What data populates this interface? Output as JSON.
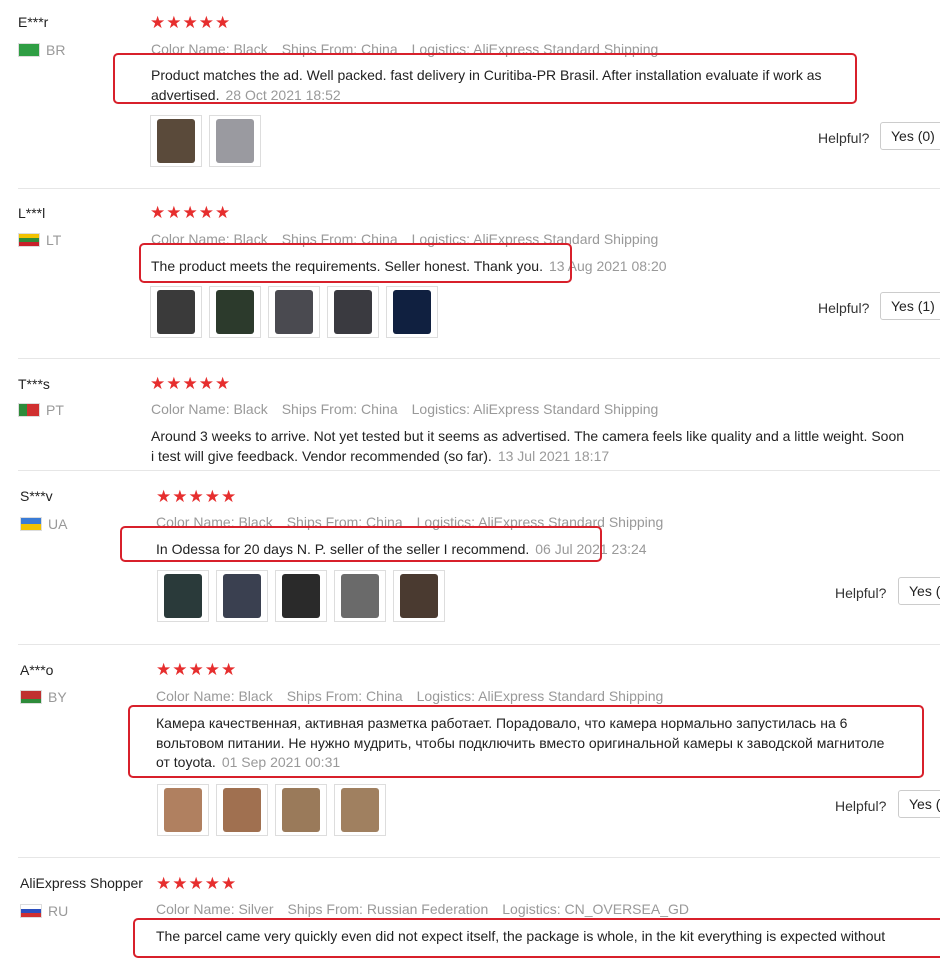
{
  "reviews": [
    {
      "user": "E***r",
      "country": "BR",
      "flag_color": "#2f9e44",
      "stars": "★★★★★",
      "color": "Color Name: Black",
      "ships": "Ships From: China",
      "logistics": "Logistics: AliExpress Standard Shipping",
      "text": "Product matches the ad. Well packed. fast delivery in Curitiba-PR Brasil. After installation evaluate if work as advertised.",
      "date": "28 Oct 2021 18:52",
      "helpful": "Helpful?",
      "yes": "Yes (0)",
      "thumbs": [
        "#5a4a3a",
        "#9a9aa0"
      ]
    },
    {
      "user": "L***l",
      "country": "LT",
      "flag_color": "#e0b020",
      "stars": "★★★★★",
      "color": "Color Name: Black",
      "ships": "Ships From: China",
      "logistics": "Logistics: AliExpress Standard Shipping",
      "text": "The product meets the requirements. Seller honest. Thank you.",
      "date": "13 Aug 2021 08:20",
      "helpful": "Helpful?",
      "yes": "Yes (1)",
      "thumbs": [
        "#3a3a3a",
        "#2c3a2c",
        "#4a4a50",
        "#3a3a40",
        "#102040"
      ]
    },
    {
      "user": "T***s",
      "country": "PT",
      "flag_color": "#d03030",
      "stars": "★★★★★",
      "color": "Color Name: Black",
      "ships": "Ships From: China",
      "logistics": "Logistics: AliExpress Standard Shipping",
      "text": "Around 3 weeks to arrive. Not yet tested but it seems as advertised. The camera feels like quality and a little weight. Soon i test will give feedback. Vendor recommended (so far).",
      "date": "13 Jul 2021 18:17"
    },
    {
      "user": "S***v",
      "country": "UA",
      "flag_color": "#3a7bd5",
      "stars": "★★★★★",
      "color": "Color Name: Black",
      "ships": "Ships From: China",
      "logistics": "Logistics: AliExpress Standard Shipping",
      "text": "In Odessa for 20 days N. P. seller of the seller I recommend.",
      "date": "06 Jul 2021 23:24",
      "helpful": "Helpful?",
      "yes": "Yes (",
      "thumbs": [
        "#2a3a3a",
        "#3a4050",
        "#2a2a2a",
        "#6a6a6a",
        "#4a3a30"
      ]
    },
    {
      "user": "A***o",
      "country": "BY",
      "flag_color": "#c03030",
      "stars": "★★★★★",
      "color": "Color Name: Black",
      "ships": "Ships From: China",
      "logistics": "Logistics: AliExpress Standard Shipping",
      "text": "Камера качественная, активная разметка работает. Порадовало, что камера нормально запустилась на 6 вольтовом питании. Не нужно мудрить, чтобы подключить вместо оригинальной камеры к заводской магнитоле от toyota.",
      "date": "01 Sep 2021 00:31",
      "helpful": "Helpful?",
      "yes": "Yes (",
      "thumbs": [
        "#b08060",
        "#a07050",
        "#9a7a5a",
        "#a08060"
      ]
    },
    {
      "user": "AliExpress Shopper",
      "country": "RU",
      "flag_color": "#2b4fbf",
      "stars": "★★★★★",
      "color": "Color Name: Silver",
      "ships": "Ships From: Russian Federation",
      "logistics": "Logistics: CN_OVERSEA_GD",
      "text": "The parcel came very quickly even did not expect itself, the package is whole, in the kit everything is expected without"
    }
  ]
}
